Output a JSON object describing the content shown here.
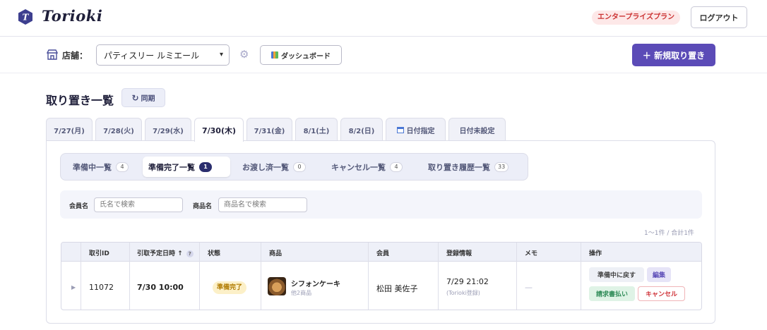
{
  "header": {
    "brand": "Torioki",
    "logo_letter": "T",
    "plan": "エンタープライズプラン",
    "logout": "ログアウト"
  },
  "storebar": {
    "label": "店舗：",
    "selected_store": "パティスリー ルミエール",
    "dashboard": "ダッシュボード",
    "new_button": "＋ 新規取り置き"
  },
  "page": {
    "title": "取り置き一覧",
    "sync": "同期"
  },
  "date_tabs": [
    {
      "label": "7/27(月)"
    },
    {
      "label": "7/28(火)"
    },
    {
      "label": "7/29(水)"
    },
    {
      "label": "7/30(木)",
      "active": true
    },
    {
      "label": "7/31(金)"
    },
    {
      "label": "8/1(土)"
    },
    {
      "label": "8/2(日)"
    },
    {
      "label": "日付指定"
    },
    {
      "label": "日付未設定"
    }
  ],
  "status_tabs": [
    {
      "label": "準備中一覧",
      "count": "4"
    },
    {
      "label": "準備完了一覧",
      "count": "1",
      "active": true
    },
    {
      "label": "お渡し済一覧",
      "count": "0"
    },
    {
      "label": "キャンセル一覧",
      "count": "4"
    },
    {
      "label": "取り置き履歴一覧",
      "count": "33"
    }
  ],
  "search": {
    "member_label": "会員名",
    "member_placeholder": "氏名で検索",
    "product_label": "商品名",
    "product_placeholder": "商品名で検索"
  },
  "result_count": "1〜1件 / 合計1件",
  "table": {
    "headers": [
      "取引ID",
      "引取予定日時 ↑",
      "状態",
      "商品",
      "会員",
      "登録情報",
      "メモ",
      "操作"
    ],
    "help_mark": "?",
    "rows": [
      {
        "id": "11072",
        "pickup": "7/30 10:00",
        "status": "準備完了",
        "product": "シフォンケーキ",
        "product_sub": "他2商品",
        "member": "松田 美佐子",
        "registered": "7/29 21:02",
        "registered_sub": "(Torioki登録)",
        "memo": "—",
        "actions": {
          "back": "準備中に戻す",
          "edit": "編集",
          "invoice": "請求書払い",
          "cancel": "キャンセル"
        }
      }
    ]
  },
  "colors": {
    "primary": "#5b4bb7",
    "navy": "#2a2e6e",
    "ready_badge_bg": "#fcf0c8",
    "cancel_red": "#d0343a"
  }
}
